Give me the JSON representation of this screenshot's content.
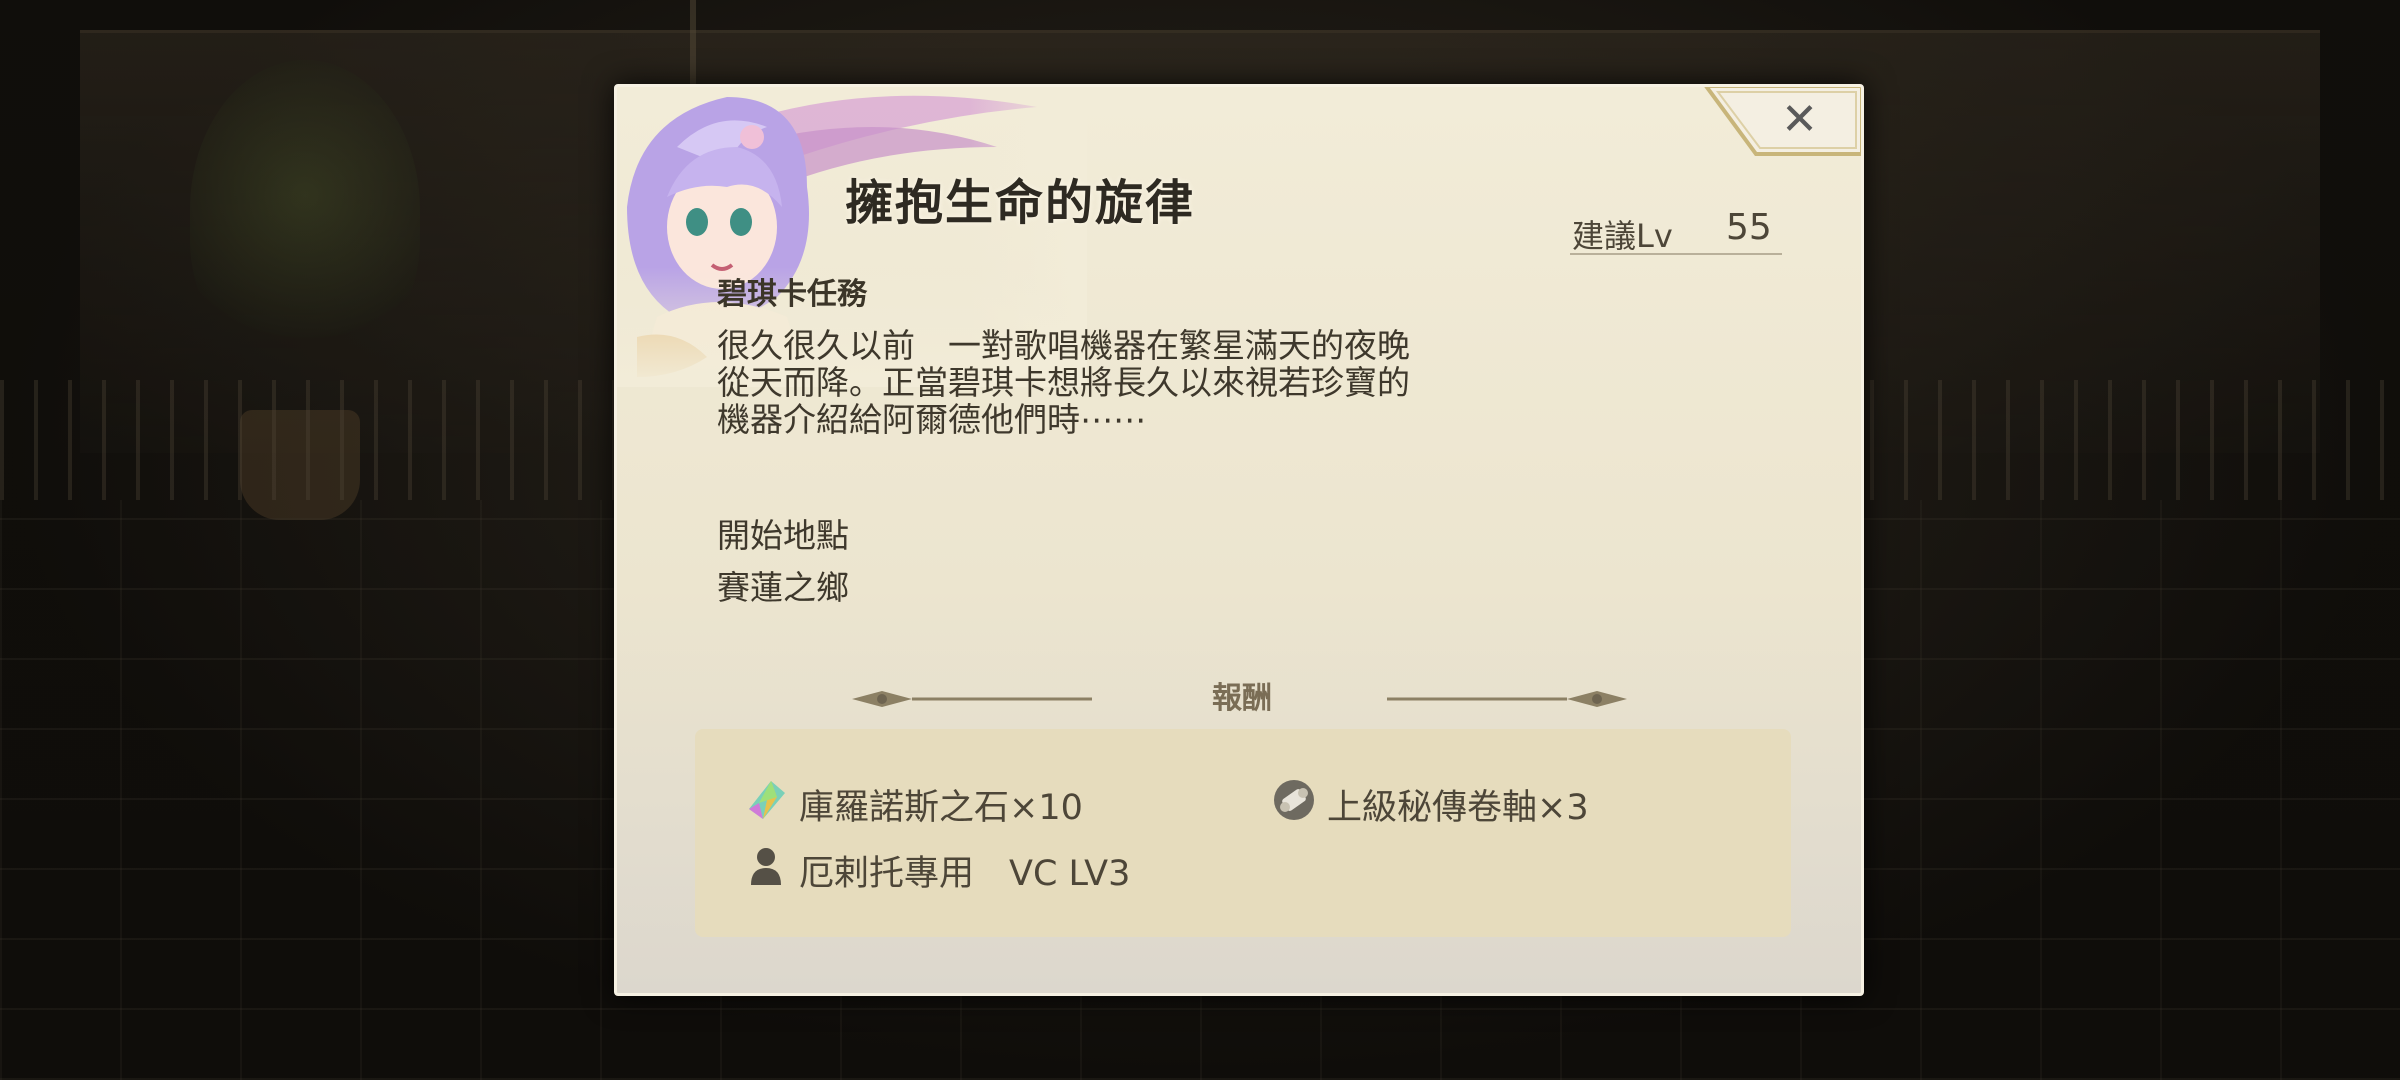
{
  "quest": {
    "title": "擁抱生命的旋律",
    "recommended_level_label": "建議Lv",
    "recommended_level_value": "55",
    "type": "碧琪卡任務",
    "description_lines": [
      "很久很久以前　一對歌唱機器在繁星滿天的夜晚",
      "從天而降。正當碧琪卡想將長久以來視若珍寶的",
      "機器介紹給阿爾德他們時⋯⋯"
    ],
    "start_location_label": "開始地點",
    "start_location_value": "賽蓮之鄉"
  },
  "rewards": {
    "header": "報酬",
    "items": [
      {
        "icon": "crystal-gem-icon",
        "label": "庫羅諾斯之石×10"
      },
      {
        "icon": "scroll-icon",
        "label": "上級秘傳卷軸×3"
      },
      {
        "icon": "person-icon",
        "label": "厄剌托專用　VC LV3"
      }
    ]
  },
  "close": {
    "icon": "close-icon",
    "symbol": "✕"
  },
  "colors": {
    "panel": "#f2ecd8",
    "reward_box": "#e6dcbd",
    "text": "#3e382c",
    "accent_gold": "#b9a46a"
  }
}
